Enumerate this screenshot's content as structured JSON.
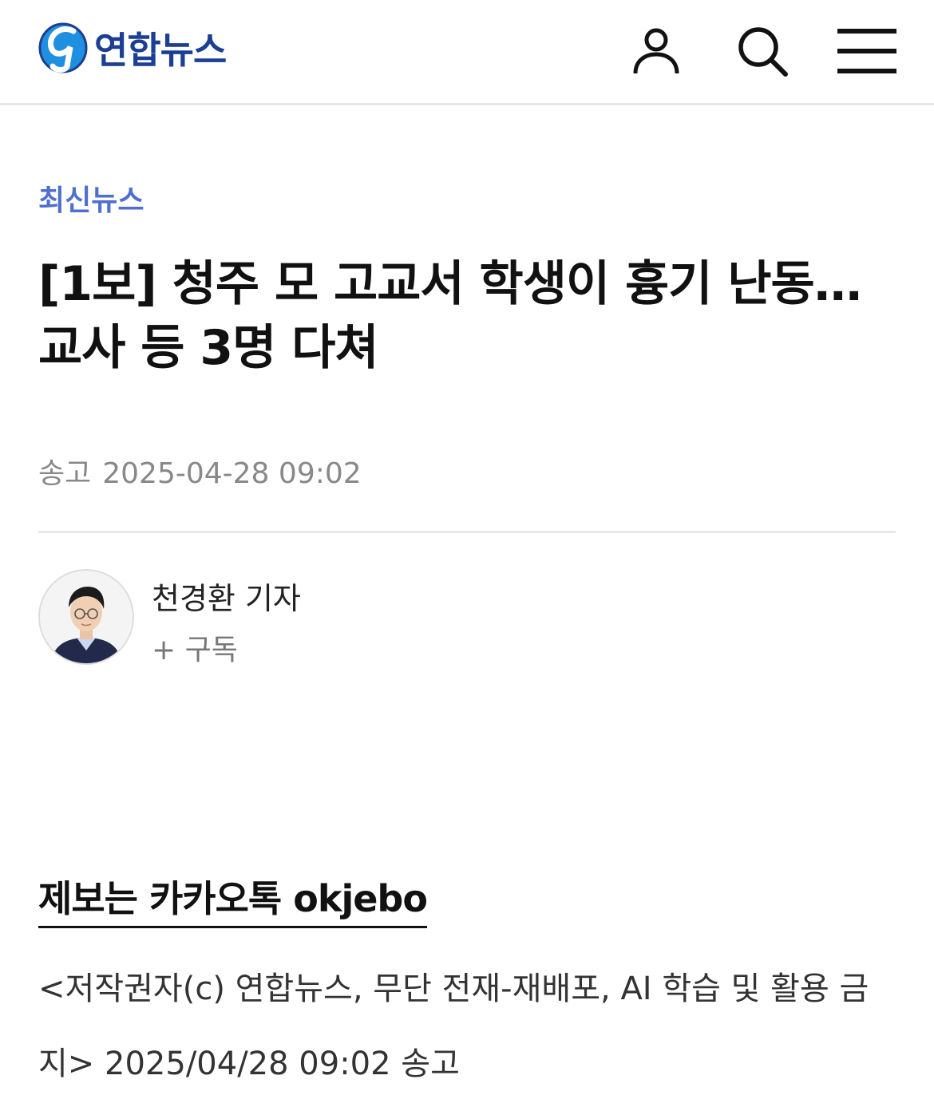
{
  "header": {
    "logo_text": "연합뉴스",
    "icons": {
      "logo": "yonhap-logo-icon",
      "user": "user-icon",
      "search": "search-icon",
      "menu": "hamburger-menu-icon"
    },
    "brand_color": "#1C3F94"
  },
  "article": {
    "category": "최신뉴스",
    "category_color": "#4F6FD0",
    "headline": "[1보] 청주 모 고교서 학생이 흉기 난동…교사 등 3명 다쳐",
    "sent_label": "송고",
    "sent_datetime": "2025-04-28 09:02"
  },
  "reporter": {
    "name": "천경환 기자",
    "subscribe_label": "+ 구독",
    "avatar_icon": "reporter-photo"
  },
  "footer": {
    "tip_text": "제보는 카카오톡 okjebo",
    "copyright": "<저작권자(c) 연합뉴스, 무단 전재-재배포, AI 학습 및 활용 금지> 2025/04/28 09:02 송고"
  }
}
